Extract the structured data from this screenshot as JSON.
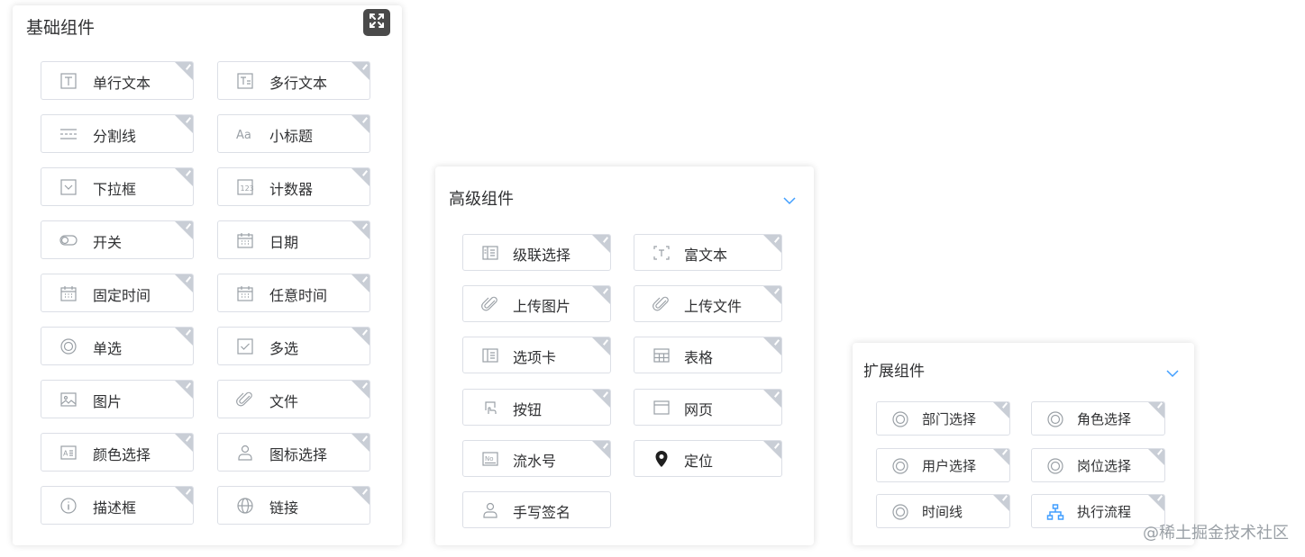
{
  "basic": {
    "title": "基础组件",
    "fullscreen_icon": "fullscreen-icon",
    "items": [
      {
        "label": "单行文本",
        "icon": "single-text-icon"
      },
      {
        "label": "多行文本",
        "icon": "multi-text-icon"
      },
      {
        "label": "分割线",
        "icon": "divider-icon"
      },
      {
        "label": "小标题",
        "icon": "subtitle-icon"
      },
      {
        "label": "下拉框",
        "icon": "dropdown-icon"
      },
      {
        "label": "计数器",
        "icon": "counter-icon"
      },
      {
        "label": "开关",
        "icon": "switch-icon"
      },
      {
        "label": "日期",
        "icon": "calendar-icon"
      },
      {
        "label": "固定时间",
        "icon": "calendar-icon"
      },
      {
        "label": "任意时间",
        "icon": "calendar-icon"
      },
      {
        "label": "单选",
        "icon": "radio-icon"
      },
      {
        "label": "多选",
        "icon": "checkbox-icon"
      },
      {
        "label": "图片",
        "icon": "image-icon"
      },
      {
        "label": "文件",
        "icon": "paperclip-icon"
      },
      {
        "label": "颜色选择",
        "icon": "color-picker-icon"
      },
      {
        "label": "图标选择",
        "icon": "user-icon"
      },
      {
        "label": "描述框",
        "icon": "info-icon"
      },
      {
        "label": "链接",
        "icon": "globe-icon"
      }
    ]
  },
  "advanced": {
    "title": "高级组件",
    "collapse_icon": "chevron-down-icon",
    "items": [
      {
        "label": "级联选择",
        "icon": "cascader-icon"
      },
      {
        "label": "富文本",
        "icon": "rich-text-icon"
      },
      {
        "label": "上传图片",
        "icon": "paperclip-icon"
      },
      {
        "label": "上传文件",
        "icon": "paperclip-icon"
      },
      {
        "label": "选项卡",
        "icon": "tabs-icon"
      },
      {
        "label": "表格",
        "icon": "table-icon"
      },
      {
        "label": "按钮",
        "icon": "hand-click-icon"
      },
      {
        "label": "网页",
        "icon": "webpage-icon"
      },
      {
        "label": "流水号",
        "icon": "serial-number-icon"
      },
      {
        "label": "定位",
        "icon": "location-pin-icon"
      },
      {
        "label": "手写签名",
        "icon": "user-icon"
      }
    ]
  },
  "extended": {
    "title": "扩展组件",
    "collapse_icon": "chevron-down-icon",
    "items": [
      {
        "label": "部门选择",
        "icon": "radio-icon"
      },
      {
        "label": "角色选择",
        "icon": "radio-icon"
      },
      {
        "label": "用户选择",
        "icon": "radio-icon"
      },
      {
        "label": "岗位选择",
        "icon": "radio-icon"
      },
      {
        "label": "时间线",
        "icon": "radio-icon"
      },
      {
        "label": "执行流程",
        "icon": "flowchart-icon"
      }
    ]
  },
  "watermark": "@稀土掘金技术社区",
  "colors": {
    "icon": "#9aa0a6",
    "accent": "#409eff",
    "corner": "#c9ced6",
    "border": "#dcdfe6"
  }
}
